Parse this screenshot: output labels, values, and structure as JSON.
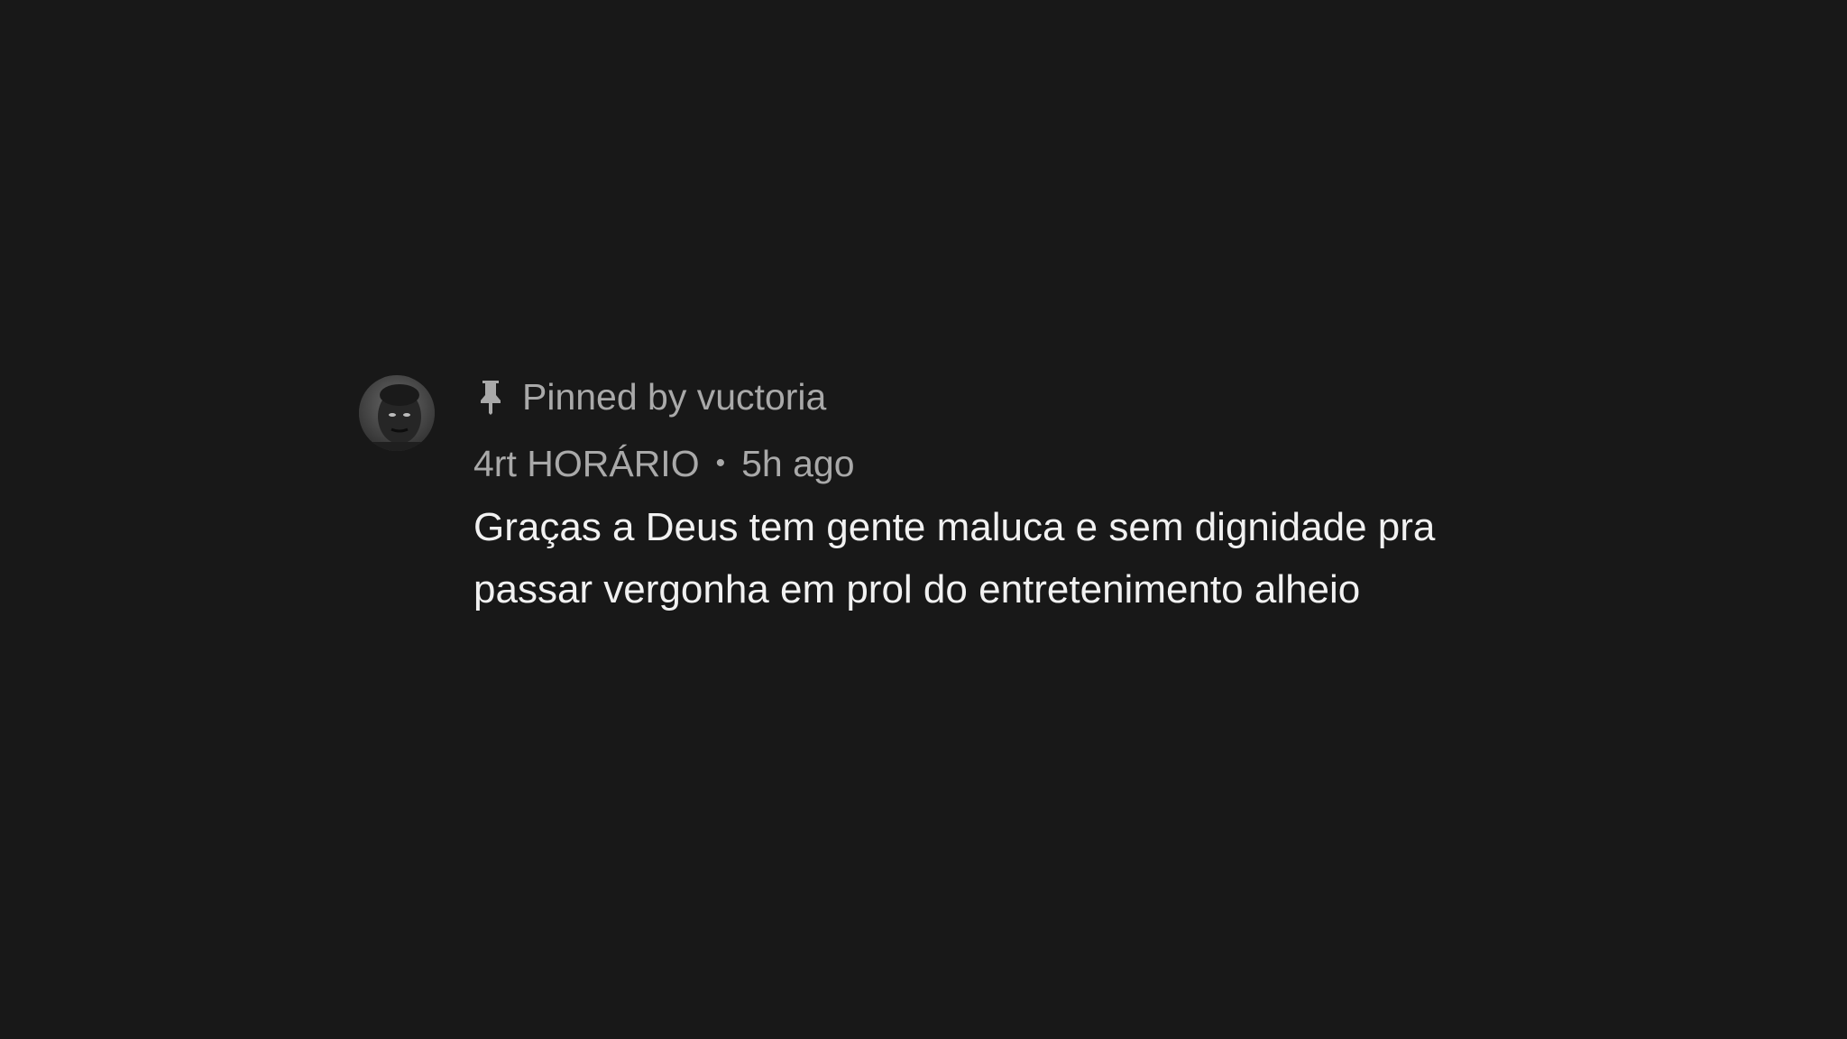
{
  "comment": {
    "pinned_label": "Pinned by vuctoria",
    "author": "4rt HORÁRIO",
    "separator": "•",
    "timestamp": "5h ago",
    "text": "Graças a Deus tem gente maluca e sem dignidade pra passar vergonha em prol do entretenimento alheio",
    "icons": {
      "pin": "pin-icon",
      "avatar": "avatar"
    },
    "colors": {
      "background": "#181818",
      "meta_text": "#a9a9a9",
      "body_text": "#f1f1f1"
    }
  }
}
